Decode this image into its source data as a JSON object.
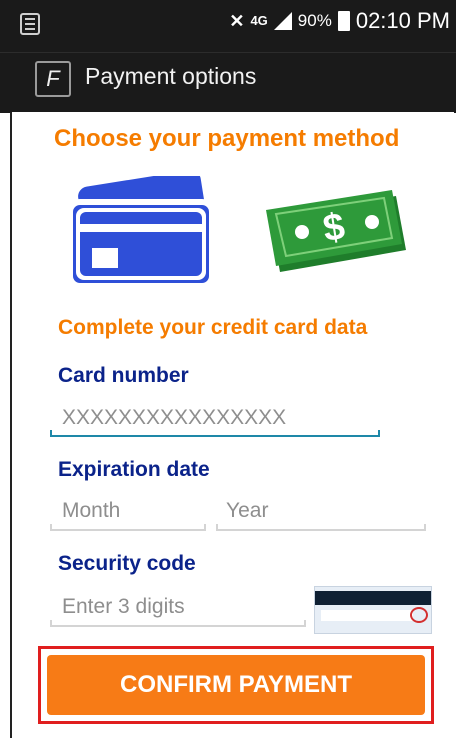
{
  "status_bar": {
    "network_label": "4G",
    "battery_percent": "90%",
    "time": "02:10 PM",
    "icons": [
      "notification-icon",
      "mute-icon",
      "signal-icon",
      "battery-icon"
    ]
  },
  "app_bar": {
    "title": "Payment options",
    "icon": "app-logo-icon"
  },
  "main": {
    "heading": "Choose your payment method",
    "methods": [
      {
        "name": "credit-card-icon",
        "color": "#2f4fd8"
      },
      {
        "name": "cash-icon",
        "color": "#2e9a3a"
      }
    ],
    "subheading": "Complete your credit card data",
    "card_number": {
      "label": "Card number",
      "placeholder": "XXXXXXXXXXXXXXXX"
    },
    "expiration": {
      "label": "Expiration date",
      "month_placeholder": "Month",
      "year_placeholder": "Year"
    },
    "security": {
      "label": "Security code",
      "placeholder": "Enter 3 digits"
    },
    "confirm_label": "CONFIRM PAYMENT"
  },
  "colors": {
    "accent_orange": "#f57c00",
    "label_blue": "#0b238a",
    "button_orange": "#f77b16",
    "highlight_red": "#e01e1e",
    "active_underline": "#1e88a8"
  }
}
